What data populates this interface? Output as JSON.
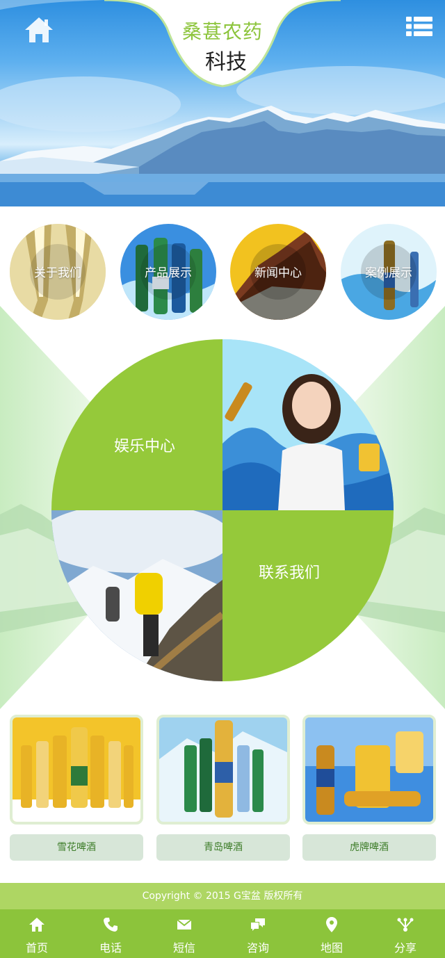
{
  "header": {
    "brand_line1": "桑葚农药",
    "brand_line2": "科技",
    "home_icon": "home-icon",
    "menu_icon": "list-menu-icon"
  },
  "nav_circles": [
    {
      "label": "关于我们"
    },
    {
      "label": "产品展示"
    },
    {
      "label": "新闻中心"
    },
    {
      "label": "案例展示"
    }
  ],
  "feature": {
    "top_left": "娱乐中心",
    "bottom_right": "联系我们"
  },
  "products": [
    {
      "caption": "雪花啤酒"
    },
    {
      "caption": "青岛啤酒"
    },
    {
      "caption": "虎牌啤酒"
    }
  ],
  "footer": {
    "copyright": "Copyright © 2015 G宝盆 版权所有"
  },
  "tabbar": [
    {
      "label": "首页",
      "icon": "home-icon"
    },
    {
      "label": "电话",
      "icon": "phone-icon"
    },
    {
      "label": "短信",
      "icon": "mail-icon"
    },
    {
      "label": "咨询",
      "icon": "chat-icon"
    },
    {
      "label": "地图",
      "icon": "map-pin-icon"
    },
    {
      "label": "分享",
      "icon": "share-icon"
    }
  ],
  "colors": {
    "accent": "#8cc43b",
    "copyright_bar": "#aed663",
    "caption_bg": "#d7e6d8",
    "caption_text": "#3e7d2a"
  }
}
